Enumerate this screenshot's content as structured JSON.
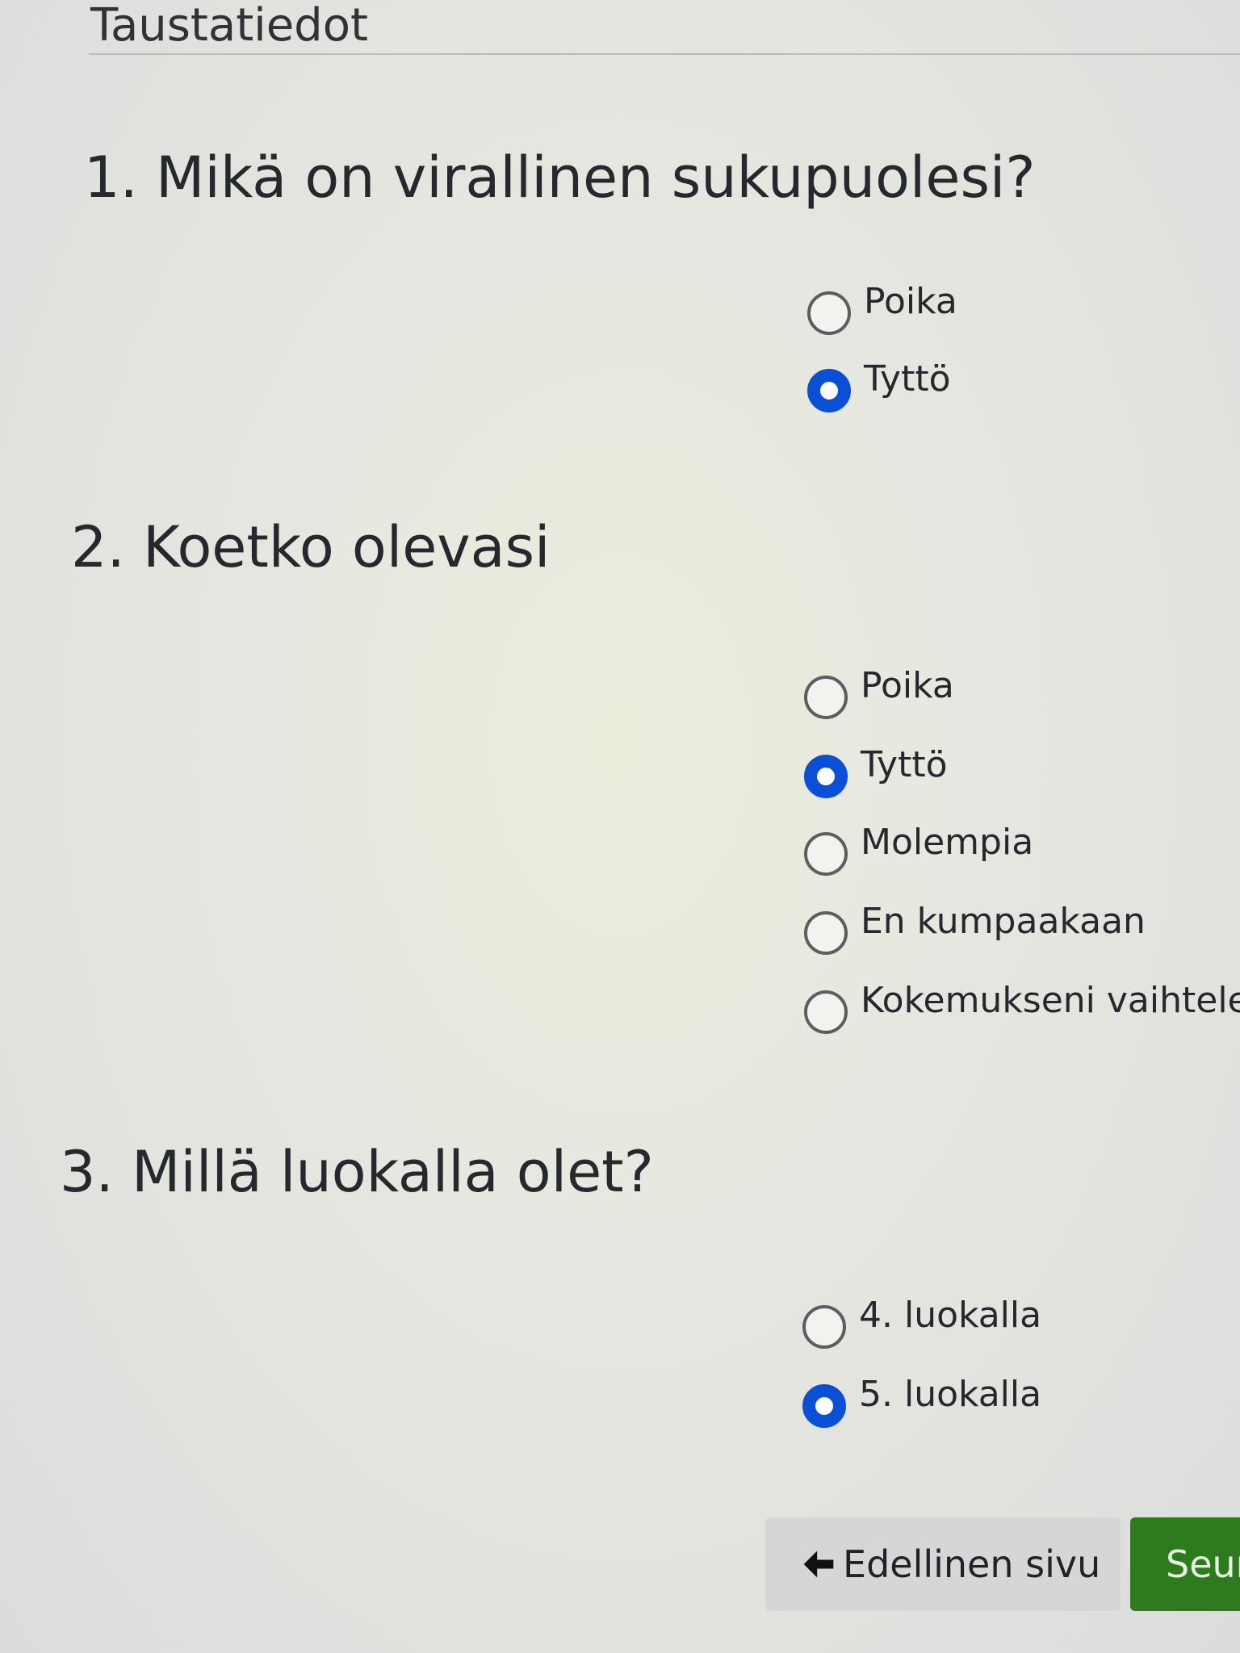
{
  "section": {
    "title": "Taustatiedot"
  },
  "questions": [
    {
      "title": "1. Mikä on virallinen sukupuolesi?",
      "options": [
        {
          "label": "Poika",
          "selected": false
        },
        {
          "label": "Tyttö",
          "selected": true
        }
      ]
    },
    {
      "title": "2. Koetko olevasi",
      "options": [
        {
          "label": "Poika",
          "selected": false
        },
        {
          "label": "Tyttö",
          "selected": true
        },
        {
          "label": "Molempia",
          "selected": false
        },
        {
          "label": "En kumpaakaan",
          "selected": false
        },
        {
          "label": "Kokemukseni vaihtele",
          "selected": false
        }
      ]
    },
    {
      "title": "3. Millä luokalla olet?",
      "options": [
        {
          "label": "4. luokalla",
          "selected": false
        },
        {
          "label": "5. luokalla",
          "selected": true
        }
      ]
    }
  ],
  "navigation": {
    "prev_label": "Edellinen sivu",
    "next_label": "Seur",
    "prev_icon": "arrow-left-icon"
  },
  "colors": {
    "radio_selected": "#0b4fd6",
    "next_button": "#2d7a1f",
    "prev_button": "#d6d6d6"
  }
}
